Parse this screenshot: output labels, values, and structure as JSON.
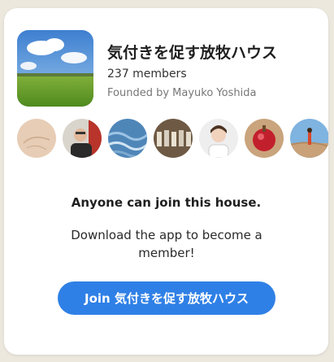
{
  "house": {
    "title": "気付きを促す放牧ハウス",
    "members": "237 members",
    "founder": "Founded by Mayuko Yoshida"
  },
  "info": {
    "anyone_can_join": "Anyone can join this house.",
    "download_prompt": "Download the app to become a member!"
  },
  "join_button": {
    "label": "Join 気付きを促す放牧ハウス"
  },
  "colors": {
    "background": "#ece8de",
    "card": "#ffffff",
    "button": "#2f80e6"
  }
}
